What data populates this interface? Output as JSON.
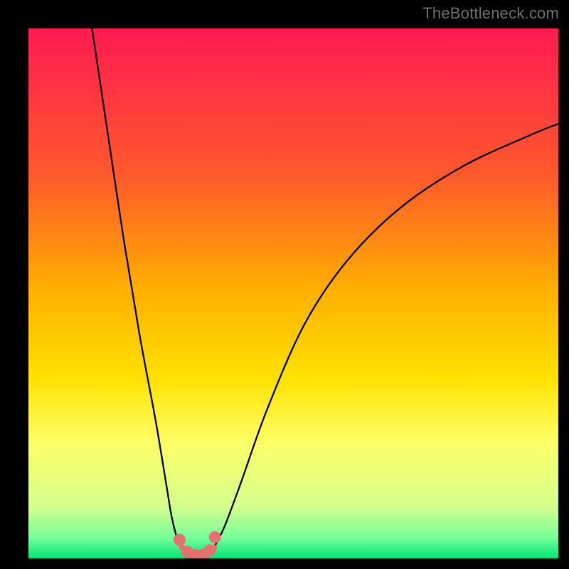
{
  "watermark": "TheBottleneck.com",
  "chart_data": {
    "type": "line",
    "title": "",
    "xlabel": "",
    "ylabel": "",
    "xlim": [
      0,
      100
    ],
    "ylim": [
      0,
      100
    ],
    "grid": false,
    "legend": false,
    "gradient_stops": [
      {
        "pct": 0,
        "color": "#ff1a52"
      },
      {
        "pct": 28,
        "color": "#ff5a2b"
      },
      {
        "pct": 50,
        "color": "#ffb200"
      },
      {
        "pct": 66,
        "color": "#ffe100"
      },
      {
        "pct": 78,
        "color": "#fdff66"
      },
      {
        "pct": 90,
        "color": "#d6ff8c"
      },
      {
        "pct": 96,
        "color": "#7bff9b"
      },
      {
        "pct": 100,
        "color": "#00e676"
      }
    ],
    "series": [
      {
        "name": "left-branch",
        "x": [
          12,
          15,
          18,
          21,
          24,
          26,
          27,
          28,
          29
        ],
        "y": [
          100,
          80,
          60,
          42,
          26,
          14,
          8,
          4,
          2
        ]
      },
      {
        "name": "right-branch",
        "x": [
          35,
          37,
          40,
          45,
          52,
          60,
          70,
          82,
          95,
          100
        ],
        "y": [
          2,
          6,
          14,
          28,
          44,
          56,
          66,
          74,
          80,
          82
        ]
      },
      {
        "name": "valley-floor",
        "x": [
          29,
          30,
          31,
          32,
          33,
          34,
          35
        ],
        "y": [
          2,
          1,
          0.6,
          0.5,
          0.6,
          1,
          2
        ]
      }
    ],
    "markers": {
      "name": "valley-markers",
      "x": [
        28.5,
        30.0,
        31.5,
        33.0,
        34.2,
        35.2
      ],
      "y": [
        3.5,
        1.2,
        0.6,
        0.7,
        1.5,
        4.0
      ]
    }
  }
}
